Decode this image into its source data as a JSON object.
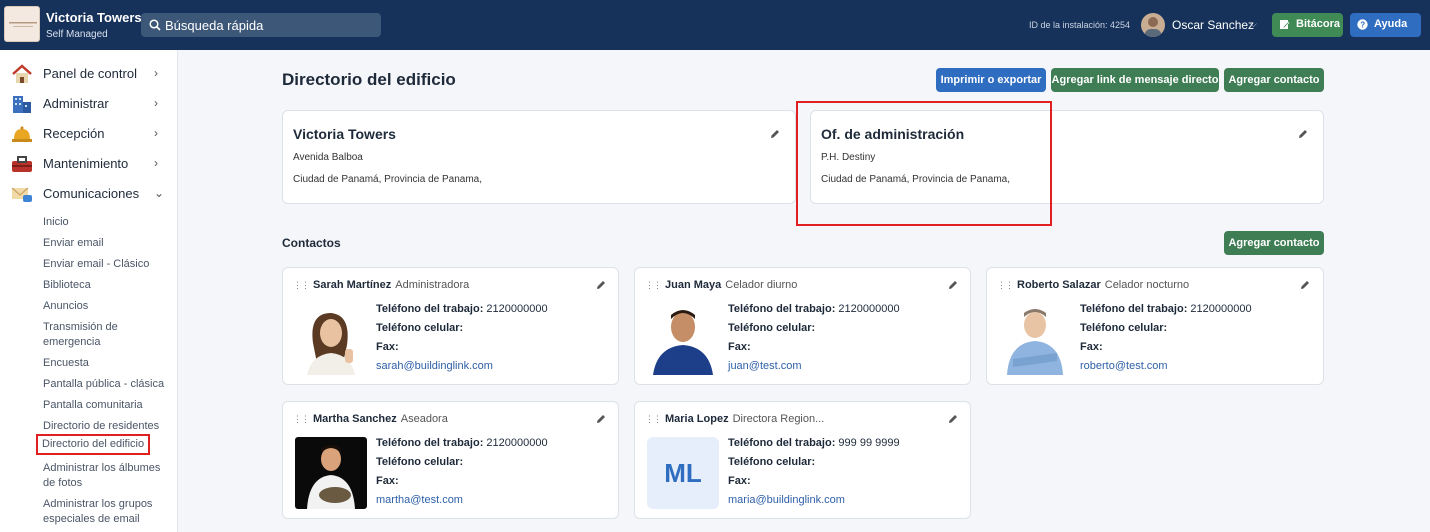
{
  "header": {
    "building_name": "Victoria Towers",
    "building_sub": "Self Managed",
    "search_placeholder": "Búsqueda rápida",
    "installation_id": "ID de la instalación: 4254",
    "user_name": "Oscar Sanchez",
    "logbook_label": "Bitácora",
    "help_label": "Ayuda"
  },
  "sidebar": {
    "items": [
      {
        "label": "Panel de control",
        "icon": "house-icon"
      },
      {
        "label": "Administrar",
        "icon": "building-icon"
      },
      {
        "label": "Recepción",
        "icon": "bell-icon"
      },
      {
        "label": "Mantenimiento",
        "icon": "toolbox-icon"
      },
      {
        "label": "Comunicaciones",
        "icon": "envelope-icon"
      }
    ],
    "subitems": [
      "Inicio",
      "Enviar email",
      "Enviar email - Clásico",
      "Biblioteca",
      "Anuncios",
      "Transmisión de emergencia",
      "Encuesta",
      "Pantalla pública - clásica",
      "Pantalla comunitaria",
      "Directorio de residentes",
      "Directorio del edificio",
      "Administrar los álbumes de fotos",
      "Administrar los grupos especiales de email"
    ]
  },
  "page": {
    "title": "Directorio del edificio",
    "print_label": "Imprimir o exportar",
    "add_link_label": "Agregar link de mensaje directo",
    "add_contact_label": "Agregar contacto"
  },
  "building_card": {
    "title": "Victoria Towers",
    "line1": "Avenida Balboa",
    "line2": "Ciudad de Panamá, Provincia de Panama,"
  },
  "admin_card": {
    "title": "Of. de administración",
    "line1": "P.H. Destiny",
    "line2": "Ciudad de Panamá, Provincia de Panama,"
  },
  "contacts_section": {
    "title": "Contactos",
    "add_label": "Agregar contacto",
    "work_phone_label": "Teléfono del trabajo:",
    "cell_label": "Teléfono celular:",
    "fax_label": "Fax:"
  },
  "contacts": [
    {
      "name": "Sarah Martínez",
      "role": "Administradora",
      "work_phone": "2120000000",
      "email": "sarah@buildinglink.com"
    },
    {
      "name": "Juan Maya",
      "role": "Celador diurno",
      "work_phone": "2120000000",
      "email": "juan@test.com"
    },
    {
      "name": "Roberto Salazar",
      "role": "Celador nocturno",
      "work_phone": "2120000000",
      "email": "roberto@test.com"
    },
    {
      "name": "Martha Sanchez",
      "role": "Aseadora",
      "work_phone": "2120000000",
      "email": "martha@test.com"
    },
    {
      "name": "Maria Lopez",
      "role": "Directora Region...",
      "work_phone": "999 99 9999",
      "email": "maria@buildinglink.com",
      "initials": "ML"
    }
  ]
}
